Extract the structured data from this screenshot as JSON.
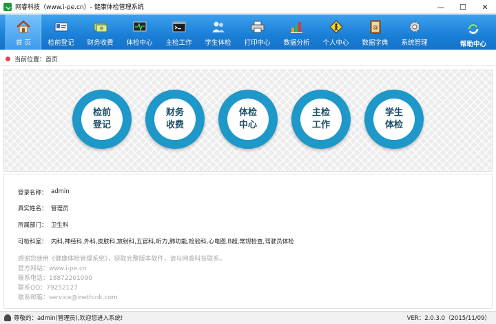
{
  "window": {
    "title": "网睿科技（www.i-pe.cn）- 健康体检管理系统",
    "controls": [
      "—",
      "☐",
      "✕"
    ]
  },
  "toolbar": {
    "items": [
      {
        "label": "首 页",
        "icon": "home-icon"
      },
      {
        "label": "检前登记",
        "icon": "id-card-icon"
      },
      {
        "label": "财务收费",
        "icon": "money-icon"
      },
      {
        "label": "体检中心",
        "icon": "monitor-icon"
      },
      {
        "label": "主检工作",
        "icon": "terminal-icon"
      },
      {
        "label": "学生体检",
        "icon": "users-icon"
      },
      {
        "label": "打印中心",
        "icon": "printer-icon"
      },
      {
        "label": "数据分析",
        "icon": "bar-chart-icon"
      },
      {
        "label": "个人中心",
        "icon": "person-sign-icon"
      },
      {
        "label": "数据字典",
        "icon": "book-icon"
      },
      {
        "label": "系统管理",
        "icon": "gear-icon"
      }
    ],
    "help_label": "帮助中心"
  },
  "breadcrumb": {
    "text": "当前位置：首页"
  },
  "banner": {
    "buttons": [
      {
        "line1": "检前",
        "line2": "登记"
      },
      {
        "line1": "财务",
        "line2": "收费"
      },
      {
        "line1": "体检",
        "line2": "中心"
      },
      {
        "line1": "主检",
        "line2": "工作"
      },
      {
        "line1": "学生",
        "line2": "体检"
      }
    ]
  },
  "info": {
    "login_label": "登录名称：",
    "login_value": "admin",
    "realname_label": "真实姓名：",
    "realname_value": "管理员",
    "dept_label": "所属部门：",
    "dept_value": "卫生科",
    "rooms_label": "可检科室：",
    "rooms_value": "内科,神经科,外科,皮肤科,放射科,五官科,听力,肺功能,检验科,心电图,B超,常规检查,驾驶员体检",
    "notice": [
      "感谢您使用《健康体检管理系统》，获取完整版本软件，请与网睿科技联系。",
      "官方网站：www.i-pe.cn",
      "联系电话：18872201090",
      "联系QQ：79252127",
      "联系邮箱：service@inethink.com"
    ]
  },
  "status": {
    "welcome": "尊敬的：admin(管理员),欢迎您进入系统!",
    "separator": "|",
    "version": "VER：2.0.3.0（2015/11/09）"
  },
  "colors": {
    "toolbar": "#1a7fd6",
    "circle": "#1e97c9"
  }
}
